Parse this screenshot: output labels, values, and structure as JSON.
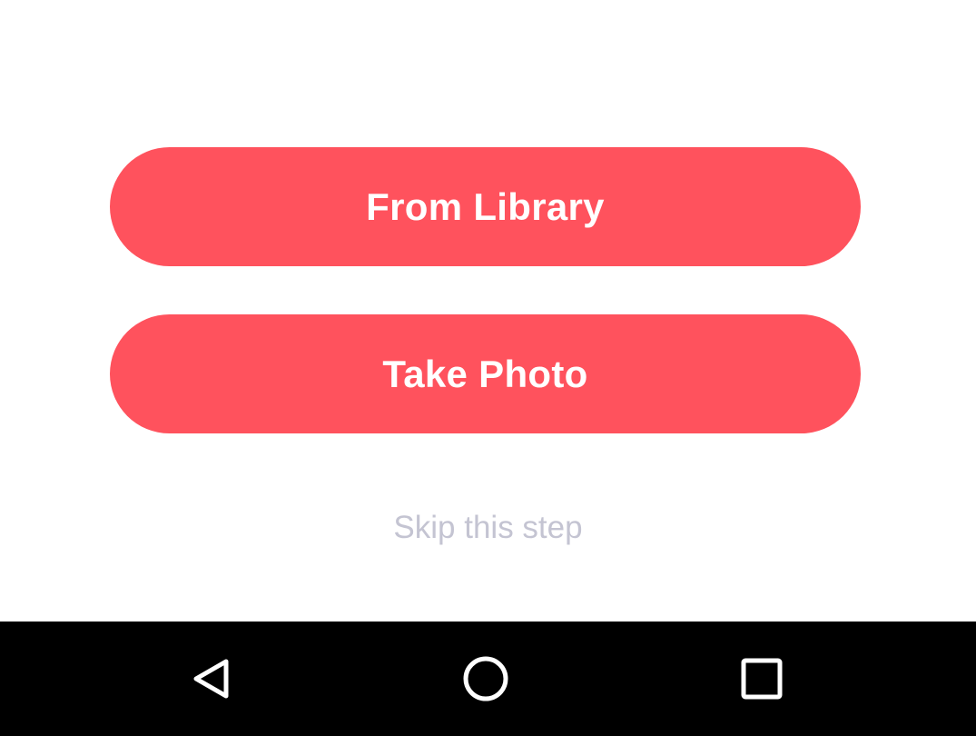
{
  "actions": {
    "from_library_label": "From Library",
    "take_photo_label": "Take Photo",
    "skip_label": "Skip this step"
  },
  "navbar": {
    "back_icon": "back-triangle-icon",
    "home_icon": "home-circle-icon",
    "recents_icon": "recents-square-icon"
  },
  "colors": {
    "accent": "#FF525D",
    "button_text": "#FFFFFF",
    "skip_text": "#C4C4D2",
    "navbar_bg": "#000000",
    "navbar_icon": "#FFFFFF"
  }
}
